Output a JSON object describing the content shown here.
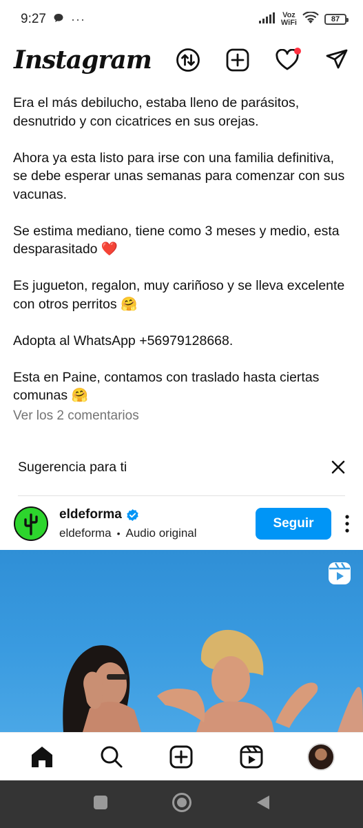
{
  "status_bar": {
    "time": "9:27",
    "network_label_top": "Voz",
    "network_label_bottom": "WiFi",
    "battery": "87"
  },
  "app": {
    "logo": "Instagram"
  },
  "post": {
    "caption_paragraphs": [
      "Era el más debilucho, estaba lleno de parásitos, desnutrido y con cicatrices en sus orejas.",
      "Ahora ya esta listo para irse con una familia definitiva,  se debe esperar unas semanas para comenzar con sus vacunas.",
      "Se estima mediano, tiene como 3 meses y medio, esta desparasitado ❤️",
      "Es jugueton, regalon, muy cariñoso y se lleva excelente con otros perritos 🤗",
      "Adopta al WhatsApp +56979128668.",
      "Esta en Paine, contamos con traslado hasta ciertas comunas 🤗"
    ],
    "view_comments": "Ver los 2 comentarios"
  },
  "suggestion": {
    "title": "Sugerencia para ti",
    "account_name": "eldeforma",
    "account_handle": "eldeforma",
    "separator": "•",
    "audio": "Audio original",
    "follow_label": "Seguir"
  },
  "icons": {
    "activity": "activity-icon",
    "create": "plus-square-icon",
    "notifications": "heart-icon",
    "direct": "paper-plane-icon",
    "verified": "verified-badge-icon",
    "reels": "reels-icon"
  },
  "colors": {
    "accent": "#0095f6",
    "notification_dot": "#ff3040",
    "avatar_bg": "#2dd52d"
  }
}
